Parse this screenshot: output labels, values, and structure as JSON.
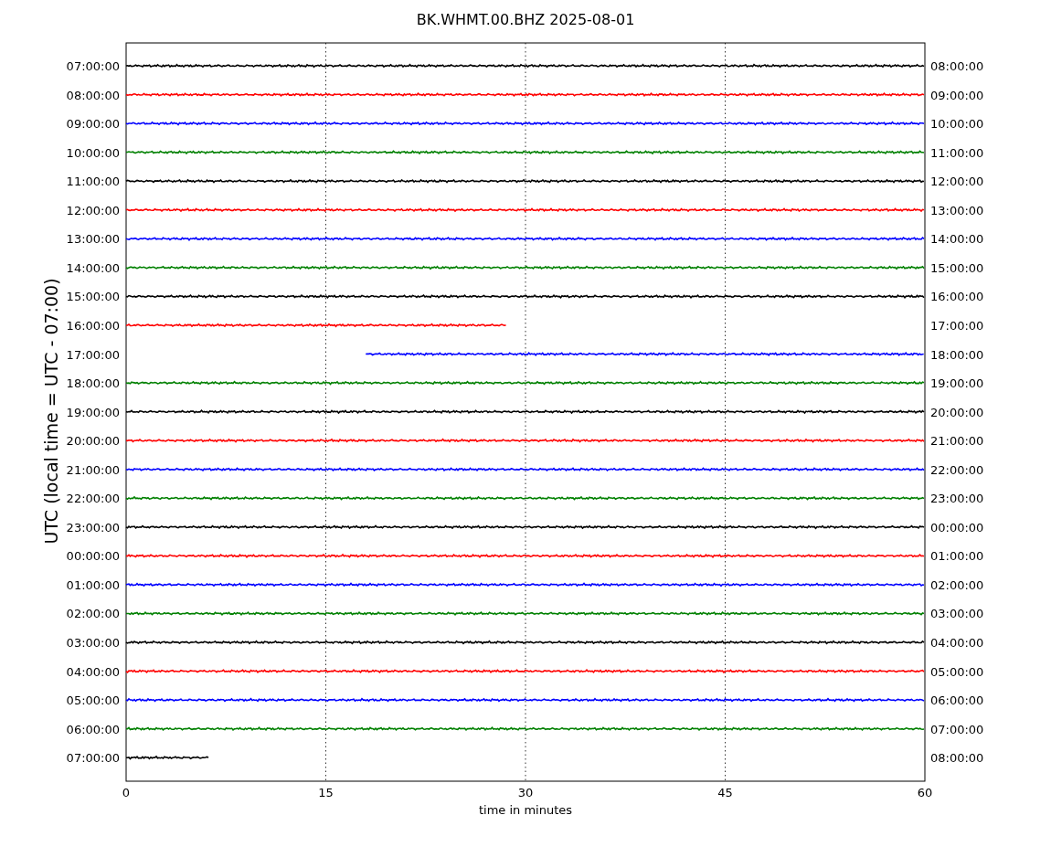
{
  "helicorder": {
    "title": "BK.WHMT.00.BHZ 2025-08-01",
    "xlabel": "time in minutes",
    "ylabel": "UTC (local time = UTC - 07:00)",
    "xtick_labels": [
      "0",
      "15",
      "30",
      "45",
      "60"
    ],
    "rows": [
      {
        "left": "07:00:00",
        "right": "08:00:00",
        "color": "#000000",
        "kind": "full"
      },
      {
        "left": "08:00:00",
        "right": "09:00:00",
        "color": "#ff0000",
        "kind": "full"
      },
      {
        "left": "09:00:00",
        "right": "10:00:00",
        "color": "#0000ff",
        "kind": "full"
      },
      {
        "left": "10:00:00",
        "right": "11:00:00",
        "color": "#008000",
        "kind": "full"
      },
      {
        "left": "11:00:00",
        "right": "12:00:00",
        "color": "#000000",
        "kind": "full"
      },
      {
        "left": "12:00:00",
        "right": "13:00:00",
        "color": "#ff0000",
        "kind": "full"
      },
      {
        "left": "13:00:00",
        "right": "14:00:00",
        "color": "#0000ff",
        "kind": "full"
      },
      {
        "left": "14:00:00",
        "right": "15:00:00",
        "color": "#008000",
        "kind": "full"
      },
      {
        "left": "15:00:00",
        "right": "16:00:00",
        "color": "#000000",
        "kind": "full"
      },
      {
        "left": "16:00:00",
        "right": "17:00:00",
        "color": "#ff0000",
        "kind": "head",
        "level": 0.477
      },
      {
        "left": "17:00:00",
        "right": "18:00:00",
        "color": "#0000ff",
        "kind": "tail",
        "level": 0.7
      },
      {
        "left": "18:00:00",
        "right": "19:00:00",
        "color": "#008000",
        "kind": "full"
      },
      {
        "left": "19:00:00",
        "right": "20:00:00",
        "color": "#000000",
        "kind": "full"
      },
      {
        "left": "20:00:00",
        "right": "21:00:00",
        "color": "#ff0000",
        "kind": "full"
      },
      {
        "left": "21:00:00",
        "right": "22:00:00",
        "color": "#0000ff",
        "kind": "full"
      },
      {
        "left": "22:00:00",
        "right": "23:00:00",
        "color": "#008000",
        "kind": "full"
      },
      {
        "left": "23:00:00",
        "right": "00:00:00",
        "color": "#000000",
        "kind": "full"
      },
      {
        "left": "00:00:00",
        "right": "01:00:00",
        "color": "#ff0000",
        "kind": "full"
      },
      {
        "left": "01:00:00",
        "right": "02:00:00",
        "color": "#0000ff",
        "kind": "full"
      },
      {
        "left": "02:00:00",
        "right": "03:00:00",
        "color": "#008000",
        "kind": "full"
      },
      {
        "left": "03:00:00",
        "right": "04:00:00",
        "color": "#000000",
        "kind": "full"
      },
      {
        "left": "04:00:00",
        "right": "05:00:00",
        "color": "#ff0000",
        "kind": "full"
      },
      {
        "left": "05:00:00",
        "right": "06:00:00",
        "color": "#0000ff",
        "kind": "full"
      },
      {
        "left": "06:00:00",
        "right": "07:00:00",
        "color": "#008000",
        "kind": "full"
      },
      {
        "left": "07:00:00",
        "right": "08:00:00",
        "color": "#000000",
        "kind": "head",
        "level": 0.103
      }
    ]
  }
}
